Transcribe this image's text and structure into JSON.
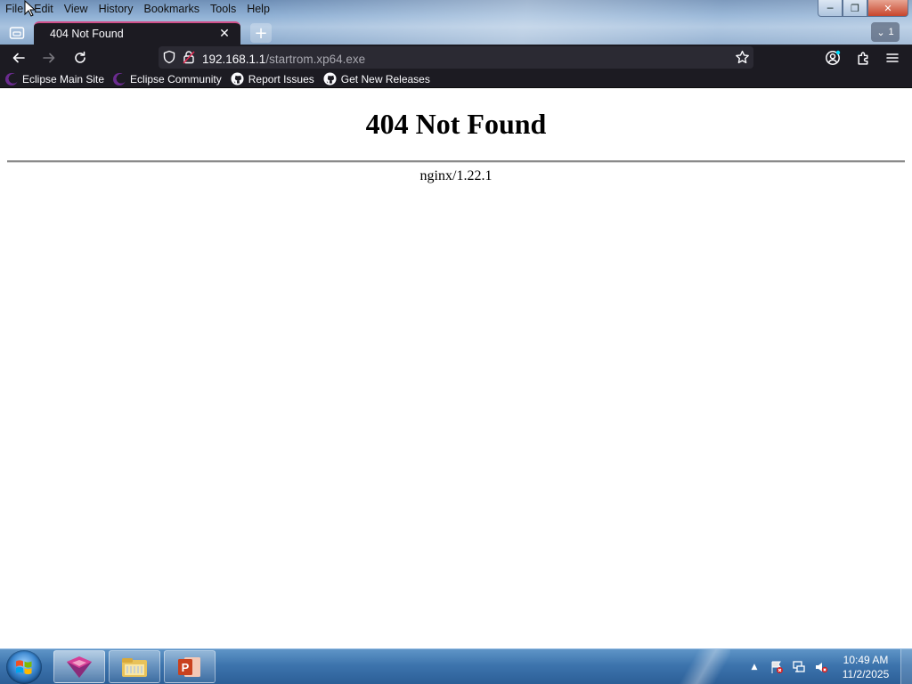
{
  "menu": [
    "File",
    "Edit",
    "View",
    "History",
    "Bookmarks",
    "Tools",
    "Help"
  ],
  "tab": {
    "title": "404 Not Found",
    "overflow_count": "1"
  },
  "url": {
    "host": "192.168.1.1",
    "path": "/startrom.xp64.exe"
  },
  "bookmarks": [
    {
      "label": "Eclipse Main Site",
      "icon": "eclipse-icon"
    },
    {
      "label": "Eclipse Community",
      "icon": "eclipse-icon"
    },
    {
      "label": "Report Issues",
      "icon": "github-icon"
    },
    {
      "label": "Get New Releases",
      "icon": "github-icon"
    }
  ],
  "page": {
    "heading": "404 Not Found",
    "server": "nginx/1.22.1"
  },
  "taskbar": {
    "apps": [
      {
        "name": "browser-app",
        "icon": "browser-fox-icon"
      },
      {
        "name": "file-explorer-app",
        "icon": "folder-icon"
      },
      {
        "name": "powerpoint-app",
        "icon": "powerpoint-icon"
      }
    ],
    "time": "10:49 AM",
    "date": "11/2/2025"
  },
  "colors": {
    "accent": "#d0508a",
    "toolbar": "#1c1b22",
    "urlbar": "#2b2a33",
    "text_light": "#fbfbfe"
  }
}
